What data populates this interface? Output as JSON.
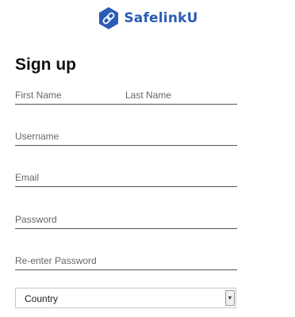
{
  "brand": {
    "name": "SafelinkU",
    "icon": "link-icon",
    "color": "#2b5bb5"
  },
  "form": {
    "title": "Sign up",
    "first_name_placeholder": "First Name",
    "last_name_placeholder": "Last Name",
    "username_placeholder": "Username",
    "email_placeholder": "Email",
    "password_placeholder": "Password",
    "reenter_password_placeholder": "Re-enter Password",
    "country_selected": "Country"
  }
}
